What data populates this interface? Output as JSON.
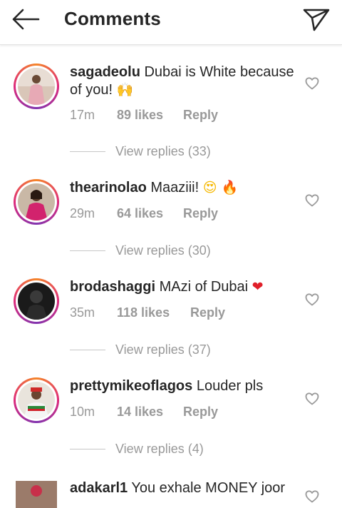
{
  "header": {
    "back_icon": "arrow-left-icon",
    "title": "Comments",
    "send_icon": "paper-plane-icon"
  },
  "comments": [
    {
      "username": "sagadeolu",
      "text": "Dubai is White because of you!",
      "emoji": "🙌",
      "time": "17m",
      "likes": "89 likes",
      "reply": "Reply",
      "view_replies": "View replies (33)"
    },
    {
      "username": "thearinolao",
      "text": "Maaziii!",
      "emoji": "😍 🔥",
      "time": "29m",
      "likes": "64 likes",
      "reply": "Reply",
      "view_replies": "View replies (30)"
    },
    {
      "username": "brodashaggi",
      "text": "MAzi of Dubai",
      "emoji": "❤",
      "time": "35m",
      "likes": "118 likes",
      "reply": "Reply",
      "view_replies": "View replies (37)"
    },
    {
      "username": "prettymikeoflagos",
      "text": "Louder pls",
      "emoji": "",
      "time": "10m",
      "likes": "14 likes",
      "reply": "Reply",
      "view_replies": "View replies (4)"
    },
    {
      "username": "adakarl1",
      "text": "You exhale MONEY joor",
      "emoji": ""
    }
  ],
  "colors": {
    "text": "#262626",
    "muted": "#999999",
    "ring_start": "#f58529",
    "ring_mid": "#dd2a7b",
    "ring_end": "#8134af"
  }
}
